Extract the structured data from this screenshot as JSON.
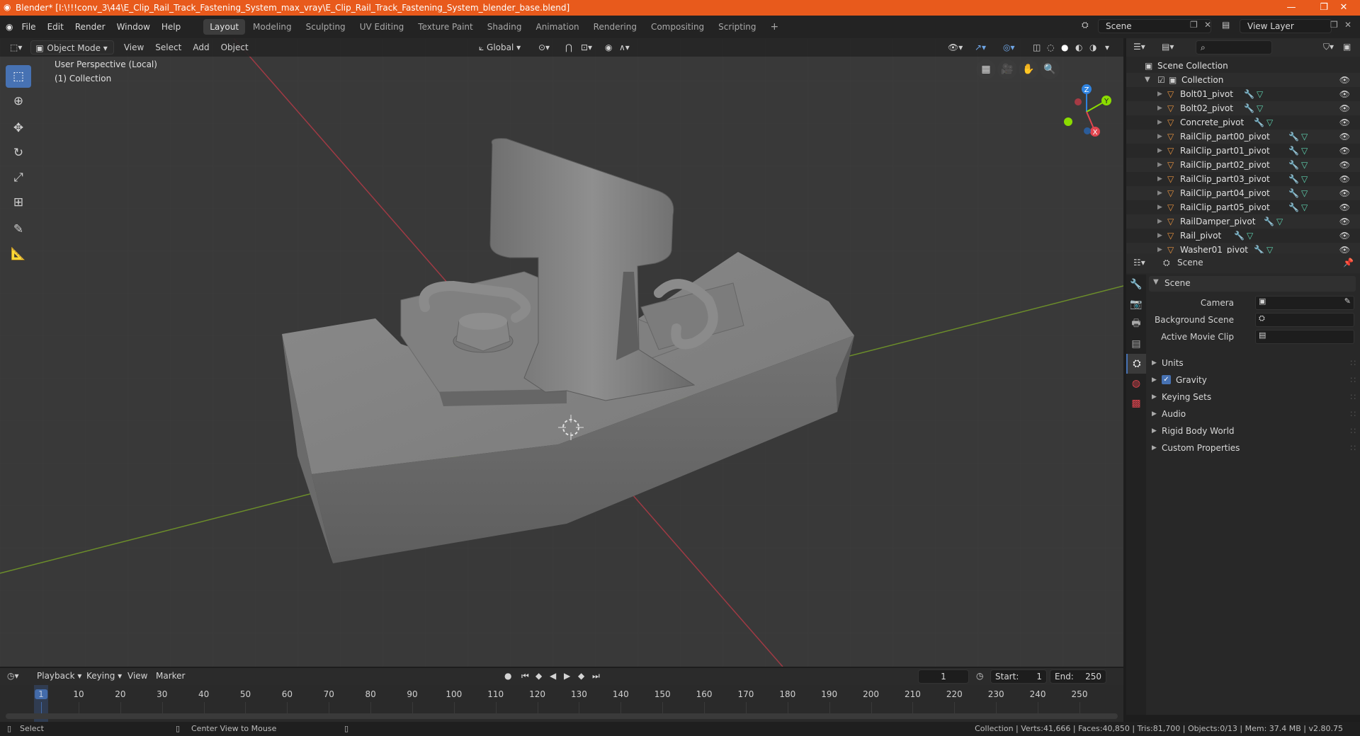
{
  "window": {
    "title": "Blender* [I:\\!!!conv_3\\44\\E_Clip_Rail_Track_Fastening_System_max_vray\\E_Clip_Rail_Track_Fastening_System_blender_base.blend]"
  },
  "menu": {
    "items": [
      "File",
      "Edit",
      "Render",
      "Window",
      "Help"
    ]
  },
  "workspaces": [
    {
      "label": "Layout",
      "active": true
    },
    {
      "label": "Modeling",
      "active": false
    },
    {
      "label": "Sculpting",
      "active": false
    },
    {
      "label": "UV Editing",
      "active": false
    },
    {
      "label": "Texture Paint",
      "active": false
    },
    {
      "label": "Shading",
      "active": false
    },
    {
      "label": "Animation",
      "active": false
    },
    {
      "label": "Rendering",
      "active": false
    },
    {
      "label": "Compositing",
      "active": false
    },
    {
      "label": "Scripting",
      "active": false
    }
  ],
  "scene_selector": {
    "value": "Scene"
  },
  "viewlayer_selector": {
    "value": "View Layer"
  },
  "viewport": {
    "mode": "Object Mode",
    "menus": [
      "View",
      "Select",
      "Add",
      "Object"
    ],
    "orientation": "Global",
    "perspective_label": "User Perspective (Local)",
    "collection_label": "(1) Collection",
    "axis_colors": {
      "x": "#e2454f",
      "y": "#8bdc00",
      "z": "#2f83e0"
    }
  },
  "outliner": {
    "root": "Scene Collection",
    "collection": "Collection",
    "items": [
      {
        "name": "Bolt01_pivot"
      },
      {
        "name": "Bolt02_pivot"
      },
      {
        "name": "Concrete_pivot"
      },
      {
        "name": "RailClip_part00_pivot"
      },
      {
        "name": "RailClip_part01_pivot"
      },
      {
        "name": "RailClip_part02_pivot"
      },
      {
        "name": "RailClip_part03_pivot"
      },
      {
        "name": "RailClip_part04_pivot"
      },
      {
        "name": "RailClip_part05_pivot"
      },
      {
        "name": "RailDamper_pivot"
      },
      {
        "name": "Rail_pivot"
      },
      {
        "name": "Washer01_pivot"
      }
    ]
  },
  "properties": {
    "header": "Scene",
    "panel": "Scene",
    "fields": [
      {
        "label": "Camera"
      },
      {
        "label": "Background Scene"
      },
      {
        "label": "Active Movie Clip"
      }
    ],
    "sections": [
      {
        "label": "Units",
        "checkbox": false
      },
      {
        "label": "Gravity",
        "checkbox": true
      },
      {
        "label": "Keying Sets",
        "checkbox": false
      },
      {
        "label": "Audio",
        "checkbox": false
      },
      {
        "label": "Rigid Body World",
        "checkbox": false
      },
      {
        "label": "Custom Properties",
        "checkbox": false
      }
    ]
  },
  "timeline": {
    "menus": [
      "Playback",
      "Keying",
      "View",
      "Marker"
    ],
    "current_frame": "1",
    "start_label": "Start:",
    "start": "1",
    "end_label": "End:",
    "end": "250",
    "ticks": [
      "1",
      "10",
      "20",
      "30",
      "40",
      "50",
      "60",
      "70",
      "80",
      "90",
      "100",
      "110",
      "120",
      "130",
      "140",
      "150",
      "160",
      "170",
      "180",
      "190",
      "200",
      "210",
      "220",
      "230",
      "240",
      "250"
    ]
  },
  "status": {
    "left_action": "Select",
    "middle_action": "Center View to Mouse",
    "stats": "Collection | Verts:41,666 | Faces:40,850 | Tris:81,700 | Objects:0/13 | Mem: 37.4 MB | v2.80.75"
  }
}
